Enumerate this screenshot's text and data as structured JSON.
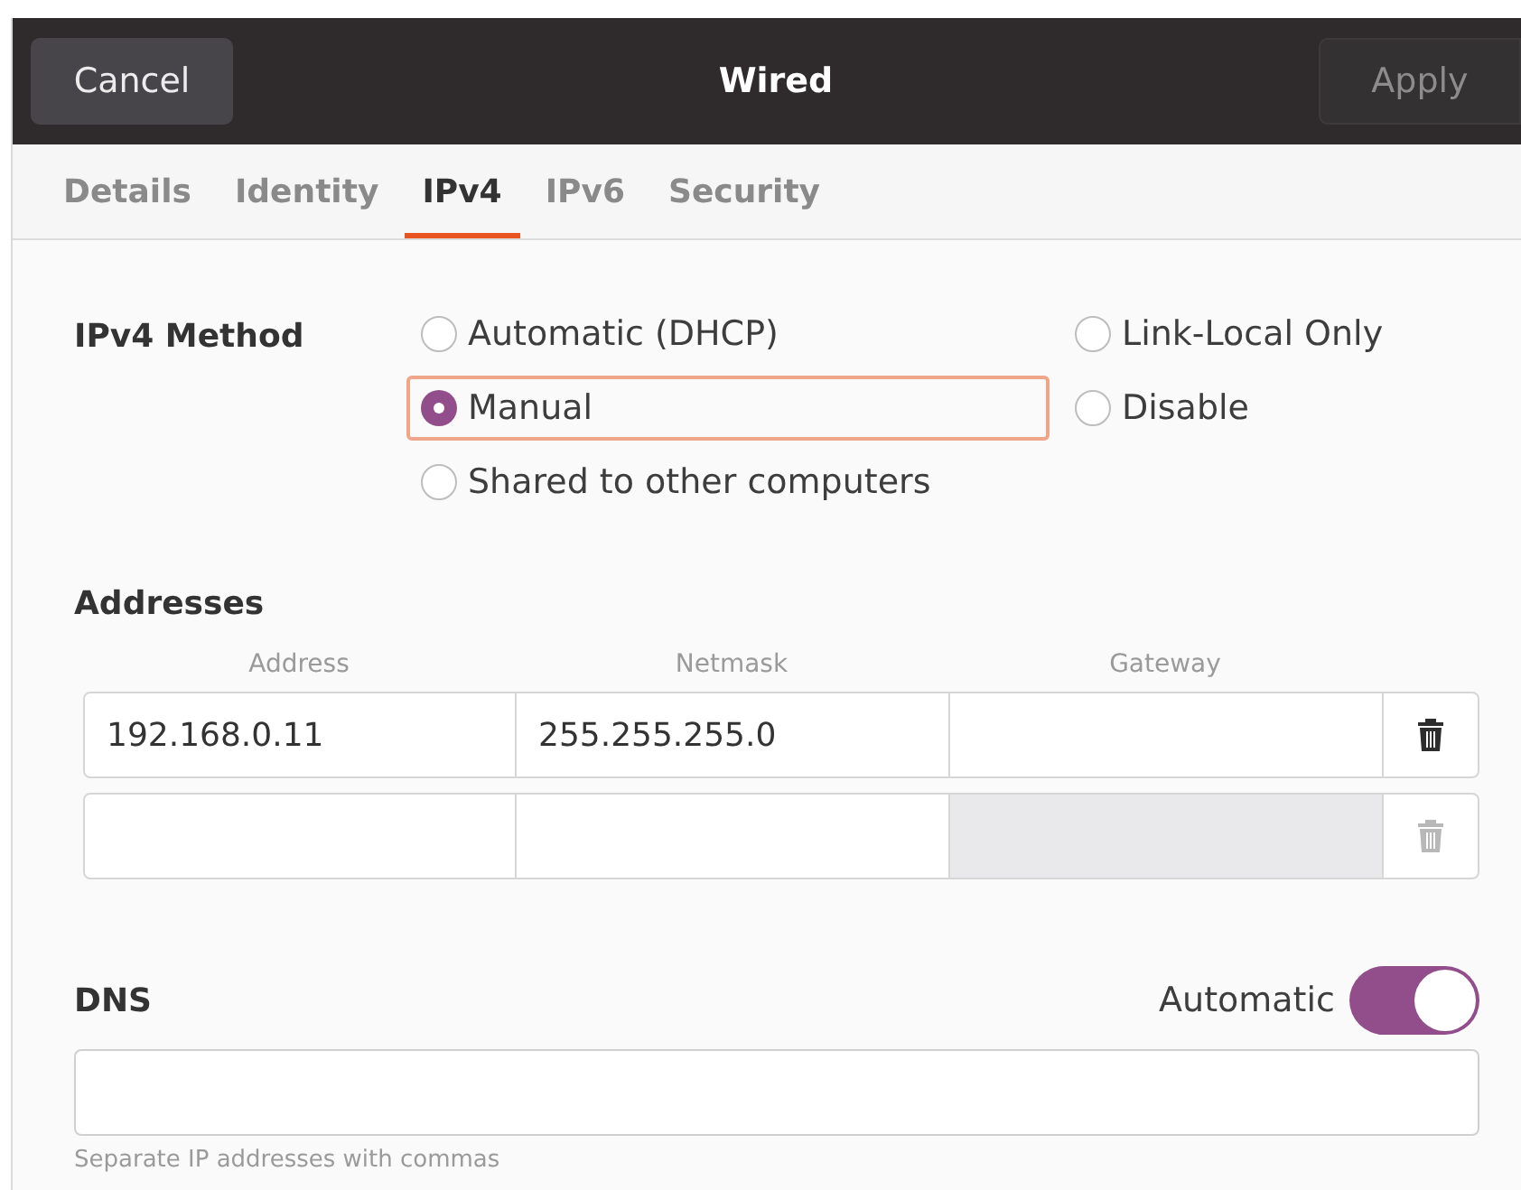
{
  "header": {
    "cancel": "Cancel",
    "title": "Wired",
    "apply": {
      "label": "Apply",
      "disabled": true
    }
  },
  "tabs": [
    {
      "label": "Details",
      "selected": false
    },
    {
      "label": "Identity",
      "selected": false
    },
    {
      "label": "IPv4",
      "selected": true
    },
    {
      "label": "IPv6",
      "selected": false
    },
    {
      "label": "Security",
      "selected": false
    }
  ],
  "method": {
    "label": "IPv4 Method",
    "options": [
      {
        "label": "Automatic (DHCP)",
        "selected": false
      },
      {
        "label": "Link-Local Only",
        "selected": false
      },
      {
        "label": "Manual",
        "selected": true
      },
      {
        "label": "Disable",
        "selected": false
      },
      {
        "label": "Shared to other computers",
        "selected": false
      }
    ]
  },
  "addresses": {
    "title": "Addresses",
    "columns": [
      "Address",
      "Netmask",
      "Gateway"
    ],
    "rows": [
      {
        "address": "192.168.0.11",
        "netmask": "255.255.255.0",
        "gateway": "",
        "disabled": false
      },
      {
        "address": "",
        "netmask": "",
        "gateway": "",
        "disabled": true
      }
    ]
  },
  "dns": {
    "title": "DNS",
    "automatic_label": "Automatic",
    "automatic_on": true,
    "hint": "Separate IP addresses with commas"
  }
}
